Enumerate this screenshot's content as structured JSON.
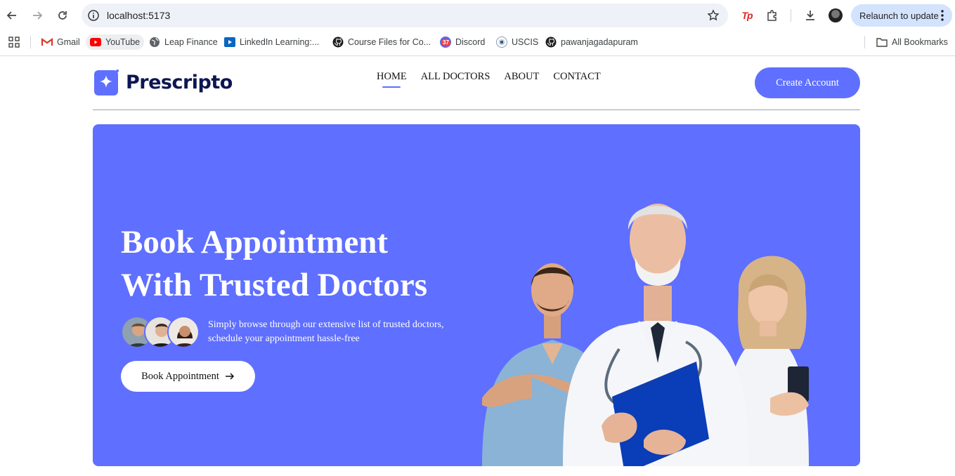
{
  "browser": {
    "url": "localhost:5173",
    "relaunch_label": "Relaunch to update",
    "bookmarks": [
      {
        "label": "Gmail",
        "icon": "gmail-icon"
      },
      {
        "label": "YouTube",
        "icon": "youtube-icon"
      },
      {
        "label": "Leap Finance",
        "icon": "globe-icon"
      },
      {
        "label": "LinkedIn Learning:...",
        "icon": "linkedin-learning-icon"
      },
      {
        "label": "Course Files for Co...",
        "icon": "github-icon"
      },
      {
        "label": "Discord",
        "icon": "discord-icon",
        "badge": "37"
      },
      {
        "label": "USCIS",
        "icon": "uscis-icon"
      },
      {
        "label": "pawanjagadapuram",
        "icon": "github-icon"
      }
    ],
    "all_bookmarks_label": "All Bookmarks"
  },
  "site": {
    "logo_text": "Prescripto",
    "nav": [
      {
        "label": "HOME",
        "active": true
      },
      {
        "label": "ALL DOCTORS",
        "active": false
      },
      {
        "label": "ABOUT",
        "active": false
      },
      {
        "label": "CONTACT",
        "active": false
      }
    ],
    "create_account_label": "Create Account"
  },
  "hero": {
    "title_line1": "Book Appointment",
    "title_line2": "With Trusted Doctors",
    "description_line1": "Simply browse through our extensive list of trusted doctors,",
    "description_line2": "schedule your appointment hassle-free",
    "button_label": "Book Appointment",
    "button_icon": "arrow-right-icon"
  },
  "colors": {
    "primary": "#5f6fff",
    "logo_text": "#0d1652",
    "relaunch_bg": "#d3e3fd"
  }
}
